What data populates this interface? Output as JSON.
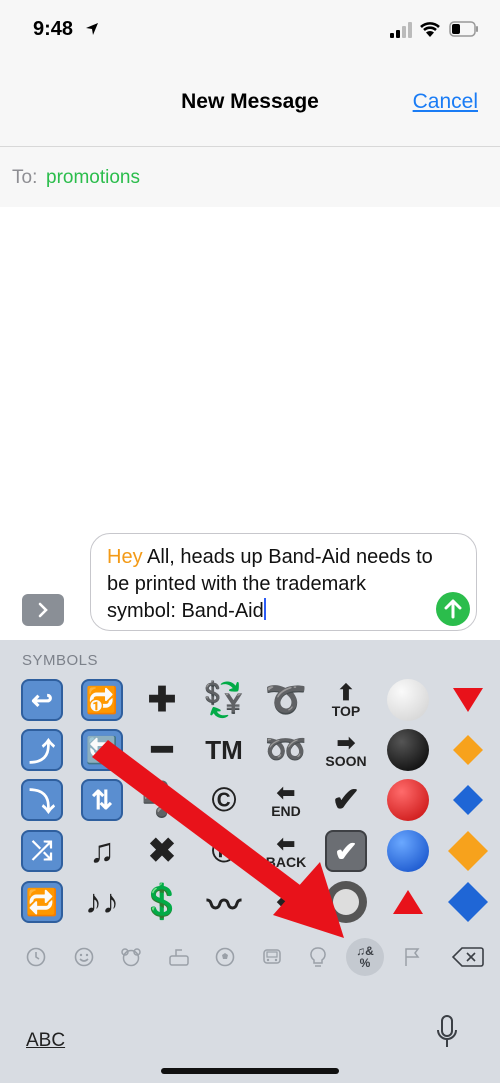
{
  "status_bar": {
    "time": "9:48"
  },
  "header": {
    "title": "New Message",
    "cancel_label": "Cancel"
  },
  "to_field": {
    "label": "To:",
    "value": "promotions"
  },
  "compose": {
    "highlight_word": "Hey",
    "body_text": " All, heads up Band-Aid needs to be printed with the trademark symbol: Band-Aid"
  },
  "keyboard": {
    "category_label": "SYMBOLS",
    "abc_label": "ABC",
    "symbols": {
      "plus": "✚",
      "minus": "━",
      "divide": "➗",
      "multiply": "✖",
      "dollar": "💲",
      "tm": "TM",
      "copyright": "©",
      "registered": "®",
      "wavy": "〰",
      "curly_loop": "➰",
      "double_loop": "➿",
      "check": "✔",
      "top": "TOP",
      "soon": "SOON",
      "end": "END",
      "back": "BACK",
      "note": "♫",
      "notes": "♪♪",
      "currency": "💱"
    },
    "tabs": [
      "recent-icon",
      "smiley-icon",
      "bear-icon",
      "food-icon",
      "ball-icon",
      "car-icon",
      "bulb-icon",
      "symbols-icon",
      "flag-icon",
      "backspace-icon"
    ],
    "active_tab_text": "♫&%"
  },
  "colors": {
    "accent_blue": "#1a7cf5",
    "green": "#2bbd4c",
    "highlight_orange": "#f39a17",
    "annotation_red": "#e8121a"
  }
}
